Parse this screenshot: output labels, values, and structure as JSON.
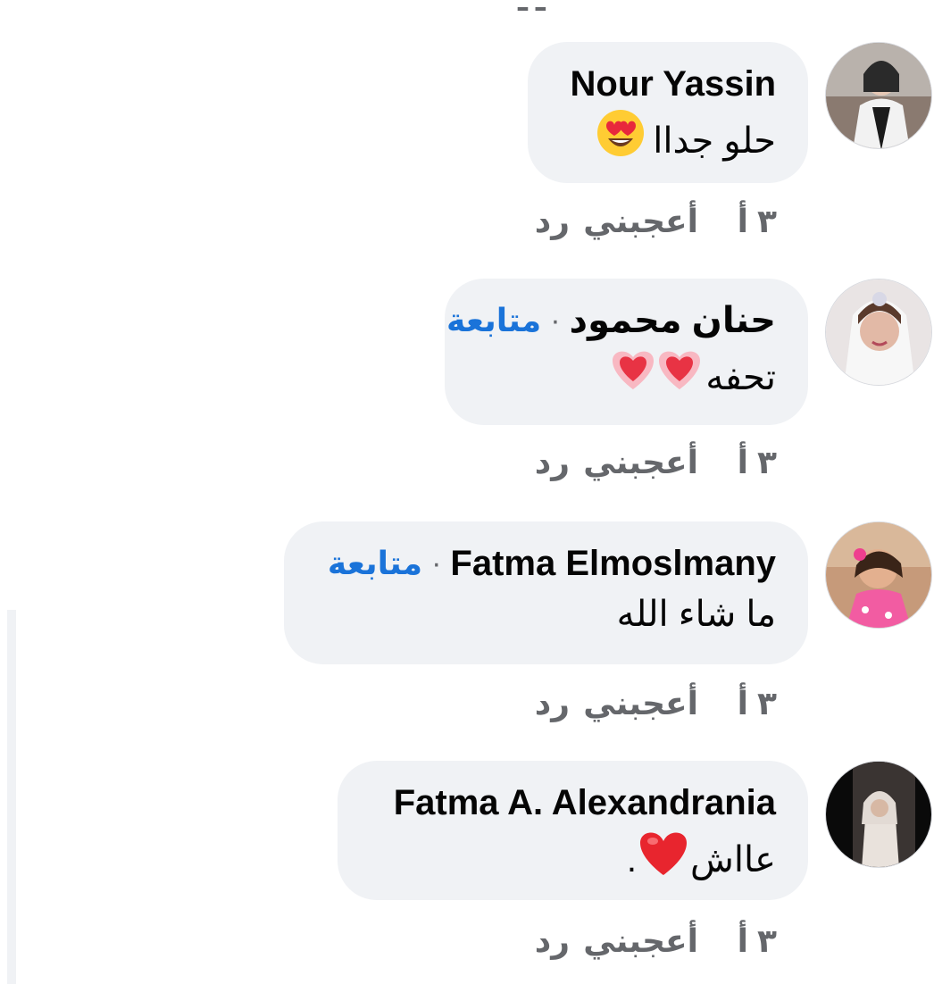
{
  "comments": [
    {
      "name": "Nour Yassin",
      "follow": "",
      "text": "حلو جداا",
      "emoji": "heart-eyes-emoji",
      "time": "٣ أ",
      "like": "أعجبني",
      "reply": "رد"
    },
    {
      "name": "حنان محمود",
      "follow": "متابعة",
      "text": "تحفه",
      "emoji": "double-pink-heart-emoji",
      "time": "٣ أ",
      "like": "أعجبني",
      "reply": "رد"
    },
    {
      "name": "Fatma Elmoslmany",
      "follow": "متابعة",
      "text": "ما شاء الله",
      "emoji": "",
      "time": "٣ أ",
      "like": "أعجبني",
      "reply": "رد"
    },
    {
      "name": "Fatma A. Alexandrania",
      "follow": "",
      "text": "عااش",
      "text_suffix": ".",
      "emoji": "red-heart-emoji",
      "time": "٣ أ",
      "like": "أعجبني",
      "reply": "رد"
    }
  ],
  "colors": {
    "bubble": "#f0f2f5",
    "follow_link": "#1a73d9",
    "meta_text": "#65676b"
  }
}
